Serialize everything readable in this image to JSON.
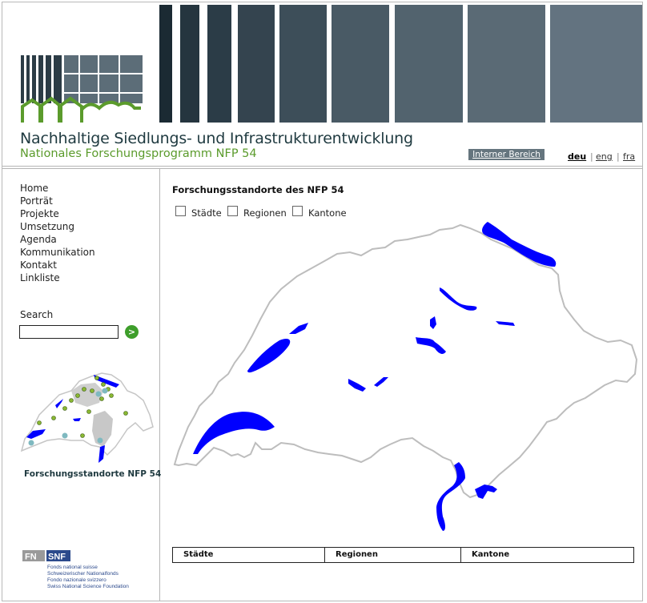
{
  "header": {
    "bar_colors": [
      "#1b2a33",
      "#25353f",
      "#2b3c47",
      "#34444f",
      "#3d4e59",
      "#495a65",
      "#52636e",
      "#5a6a75",
      "#637380"
    ],
    "title": "Nachhaltige Siedlungs- und Infrastrukturentwicklung",
    "subtitle": "Nationales Forschungsprogramm NFP 54",
    "intern_link": "Interner Bereich",
    "languages": [
      "deu",
      "eng",
      "fra"
    ],
    "active_language": "deu",
    "language_separator": "|"
  },
  "sidebar": {
    "nav": [
      "Home",
      "Porträt",
      "Projekte",
      "Umsetzung",
      "Agenda",
      "Kommunikation",
      "Kontakt",
      "Linkliste"
    ],
    "search_label": "Search",
    "search_value": "",
    "search_button": ">",
    "minimap_caption": "Forschungsstandorte NFP 54",
    "snf_logo_text": [
      "FN",
      "SNF"
    ],
    "snf_names": [
      "Fonds national suisse",
      "Schweizerischer Nationalfonds",
      "Fondo nazionale svizzero",
      "Swiss National Science Foundation"
    ]
  },
  "main": {
    "title": "Forschungsstandorte des NFP 54",
    "filters": [
      {
        "label": "Städte",
        "checked": false
      },
      {
        "label": "Regionen",
        "checked": false
      },
      {
        "label": "Kantone",
        "checked": false
      }
    ],
    "table_headers": [
      "Städte",
      "Regionen",
      "Kantone"
    ]
  },
  "colors": {
    "lake": "#0000ff",
    "border": "#b8b8b8",
    "brand_green": "#5b9b2c",
    "brand_dark": "#1f3a40"
  }
}
